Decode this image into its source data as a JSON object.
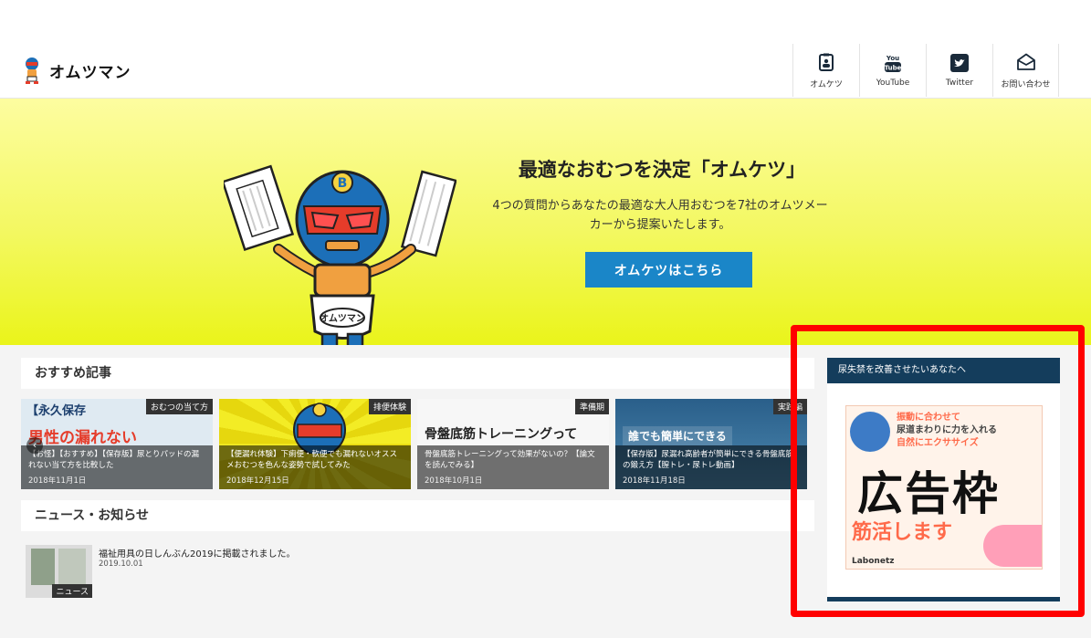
{
  "header": {
    "logo_text": "オムツマン",
    "nav": [
      {
        "label": "オムケツ",
        "icon": "clipboard-icon"
      },
      {
        "label": "YouTube",
        "icon": "youtube-icon"
      },
      {
        "label": "Twitter",
        "icon": "twitter-icon"
      },
      {
        "label": "お問い合わせ",
        "icon": "mail-icon"
      }
    ]
  },
  "hero": {
    "title": "最適なおむつを決定「オムケツ」",
    "desc_line1": "4つの質問からあなたの最適な大人用おむつを7社のオムツメー",
    "desc_line2": "カーから提案いたします。",
    "button_label": "オムケツはこちら",
    "mascot_badge": "オムツマン"
  },
  "recommended": {
    "heading": "おすすめ記事",
    "cards": [
      {
        "tag": "おむつの当て方",
        "bigtext": "男性の漏れない",
        "title": "【お怪】【おすすめ】【保存版】尿とりパッドの漏れない当て方を比較した",
        "date": "2018年11月1日"
      },
      {
        "tag": "排便体験",
        "bigtext": "",
        "title": "【便漏れ体験】下痢便・軟便でも漏れないオススメおむつを色んな姿勢で試してみた",
        "date": "2018年12月15日"
      },
      {
        "tag": "準備期",
        "bigtext": "骨盤底筋トレーニングって",
        "title": "骨盤底筋トレーニングって効果がないの？【論文を読んでみる】",
        "date": "2018年10月1日"
      },
      {
        "tag": "実践編",
        "bigtext": "誰でも簡単にできる",
        "title": "【保存版】尿漏れ高齢者が簡単にできる骨盤底筋の鍛え方【膣トレ・尿トレ動画】",
        "date": "2018年11月18日"
      }
    ]
  },
  "news": {
    "heading": "ニュース・お知らせ",
    "items": [
      {
        "title": "福祉用具の日しんぶん2019に掲載されました。",
        "date": "2019.10.01",
        "badge": "ニュース"
      }
    ]
  },
  "sidebar": {
    "heading": "尿失禁を改善させたいあなたへ",
    "ad_label": "広告枠",
    "ad_headline_1": "振動に合わせて",
    "ad_headline_2": "尿道まわりに力を入れる",
    "ad_headline_3": "自然にエクササイズ",
    "ad_bottom": "筋活します",
    "ad_brand": "Labonetz"
  },
  "colors": {
    "accent_button": "#1a86c8",
    "sidebar_header": "#143d5c",
    "highlight": "#ff0000",
    "hero_yellow": "#eaf41a"
  }
}
